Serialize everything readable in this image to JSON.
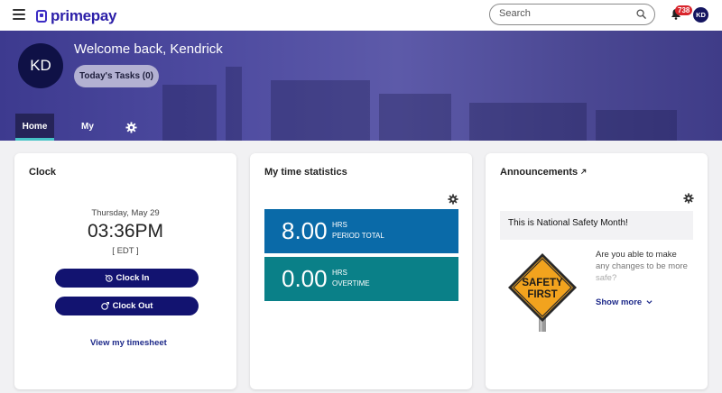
{
  "topbar": {
    "logo_text": "primepay",
    "search": {
      "placeholder": "Search",
      "value": ""
    },
    "notifications_count": "738",
    "avatar_initials": "KD"
  },
  "banner": {
    "avatar_initials": "KD",
    "welcome": "Welcome back, Kendrick",
    "tasks_button": "Today's Tasks (0)",
    "tabs": [
      {
        "label": "Home",
        "active": true
      },
      {
        "label": "My Dashboard",
        "active": false
      }
    ]
  },
  "clock": {
    "title": "Clock",
    "date": "Thursday, May 29",
    "time": "03:36PM",
    "timezone": "[ EDT ]",
    "clock_in": "Clock In",
    "clock_out": "Clock Out",
    "timesheet_link": "View my timesheet"
  },
  "time_stats": {
    "title": "My time statistics",
    "items": [
      {
        "value": "8.00",
        "unit": "HRS",
        "label": "PERIOD TOTAL",
        "color": "#0a6aa8"
      },
      {
        "value": "0.00",
        "unit": "HRS",
        "label": "OVERTIME",
        "color": "#0a8088"
      }
    ]
  },
  "announcements": {
    "title": "Announcements",
    "headline": "This is National Safety Month!",
    "sign_text_1": "SAFETY",
    "sign_text_2": "FIRST",
    "body_line_1": "Are you able to make",
    "body_line_2": "any changes to be more",
    "body_line_3": "safe?",
    "show_more": "Show more"
  },
  "colors": {
    "brand": "#2c1fa8",
    "button_navy": "#121370",
    "tab_accent": "#46c2c6",
    "badge_red": "#d9262d"
  }
}
